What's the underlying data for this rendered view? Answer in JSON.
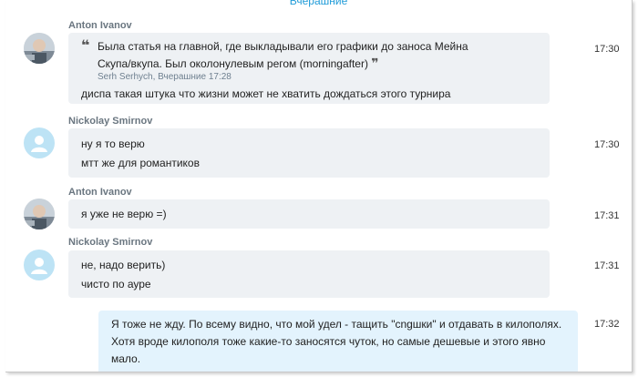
{
  "top_label": "Вчерашние",
  "messages": [
    {
      "author": "Anton Ivanov",
      "avatar": "photo",
      "time": "17:30",
      "quote": {
        "line1": "Была статья на главной, где выкладывали его графики до заноса Мейна",
        "line2": "Скупа/вкупа. Был околонулевым регом (morningafter)",
        "meta": "Serh Serhych, Вчерашние 17:28"
      },
      "lines": [
        "диспа такая штука что жизни может не хватить дождаться этого турнира"
      ]
    },
    {
      "author": "Nickolay Smirnov",
      "avatar": "default",
      "time": "17:30",
      "lines": [
        "ну я то верю",
        "мтт же для романтиков"
      ]
    },
    {
      "author": "Anton Ivanov",
      "avatar": "photo",
      "time": "17:31",
      "lines": [
        "я уже не верю =)"
      ]
    },
    {
      "author": "Nickolay Smirnov",
      "avatar": "default",
      "time": "17:31",
      "lines": [
        "не, надо верить)",
        "чисто по ауре"
      ]
    },
    {
      "author": "",
      "mine": true,
      "time": "17:32",
      "lines": [
        "Я тоже не жду. По всему видно, что мой удел - тащить \"сngшки\" и отдавать в килополях.",
        "Хотя вроде килополя тоже какие-то заносятся чуток, но самые дешевые и этого явно",
        "мало."
      ]
    }
  ],
  "colors": {
    "author": "#6a7680",
    "bubble": "#eef1f4",
    "bubble_mine": "#e3f3fd",
    "accent": "#1f9bd8",
    "default_avatar": "#bde3f5"
  },
  "icons": {
    "photo_avatar": "user-photo-avatar",
    "default_avatar": "default-user-icon",
    "quote_open": "quote-open-icon",
    "quote_close": "quote-close-icon"
  }
}
